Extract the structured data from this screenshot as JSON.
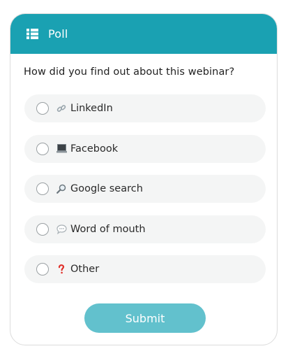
{
  "poll": {
    "title": "Poll",
    "question": "How did you find out about this webinar?",
    "options": [
      {
        "label": "LinkedIn",
        "icon": "link-icon",
        "selected": false
      },
      {
        "label": "Facebook",
        "icon": "laptop-icon",
        "selected": false
      },
      {
        "label": "Google search",
        "icon": "magnifier-icon",
        "selected": false
      },
      {
        "label": "Word of mouth",
        "icon": "speech-bubble-icon",
        "selected": false
      },
      {
        "label": "Other",
        "icon": "question-mark-icon",
        "selected": false
      }
    ],
    "submit_label": "Submit"
  },
  "colors": {
    "header": "#1aa1b2",
    "submit": "#62c1cd",
    "option_bg": "#f4f5f5"
  }
}
